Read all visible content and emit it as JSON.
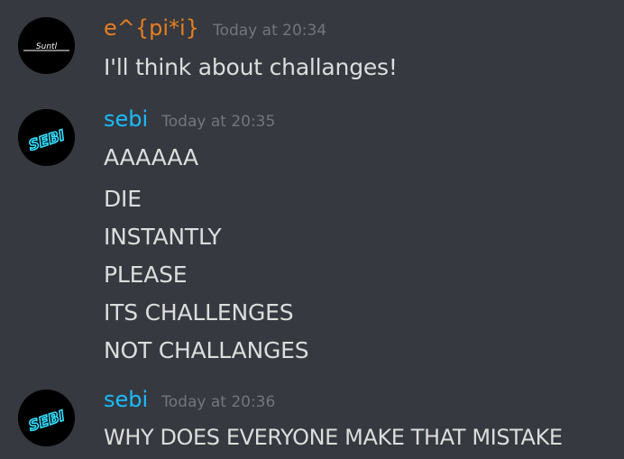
{
  "theme": {
    "background": "#36393f",
    "text": "#dcddde",
    "timestamp": "#72767d",
    "user_colors": {
      "epi": "#e67e22",
      "sebi": "#1abcfe"
    }
  },
  "messages": [
    {
      "author": "e^{pi*i}",
      "author_color": "#e67e22",
      "timestamp": "Today at 20:34",
      "avatar": {
        "icon": "avatar-suntl",
        "text": "__Suntl__"
      },
      "lines": [
        "I'll think about challanges!"
      ]
    },
    {
      "author": "sebi",
      "author_color": "#1abcfe",
      "timestamp": "Today at 20:35",
      "avatar": {
        "icon": "avatar-sebi-neon",
        "text": "SEBI"
      },
      "lines": [
        "AAAAAA",
        "DIE",
        "INSTANTLY",
        "PLEASE",
        "ITS CHALLENGES",
        "NOT CHALLANGES"
      ]
    },
    {
      "author": "sebi",
      "author_color": "#1abcfe",
      "timestamp": "Today at 20:36",
      "avatar": {
        "icon": "avatar-sebi-neon",
        "text": "SEBI"
      },
      "lines": [
        "WHY DOES EVERYONE MAKE THAT MISTAKE"
      ]
    }
  ]
}
